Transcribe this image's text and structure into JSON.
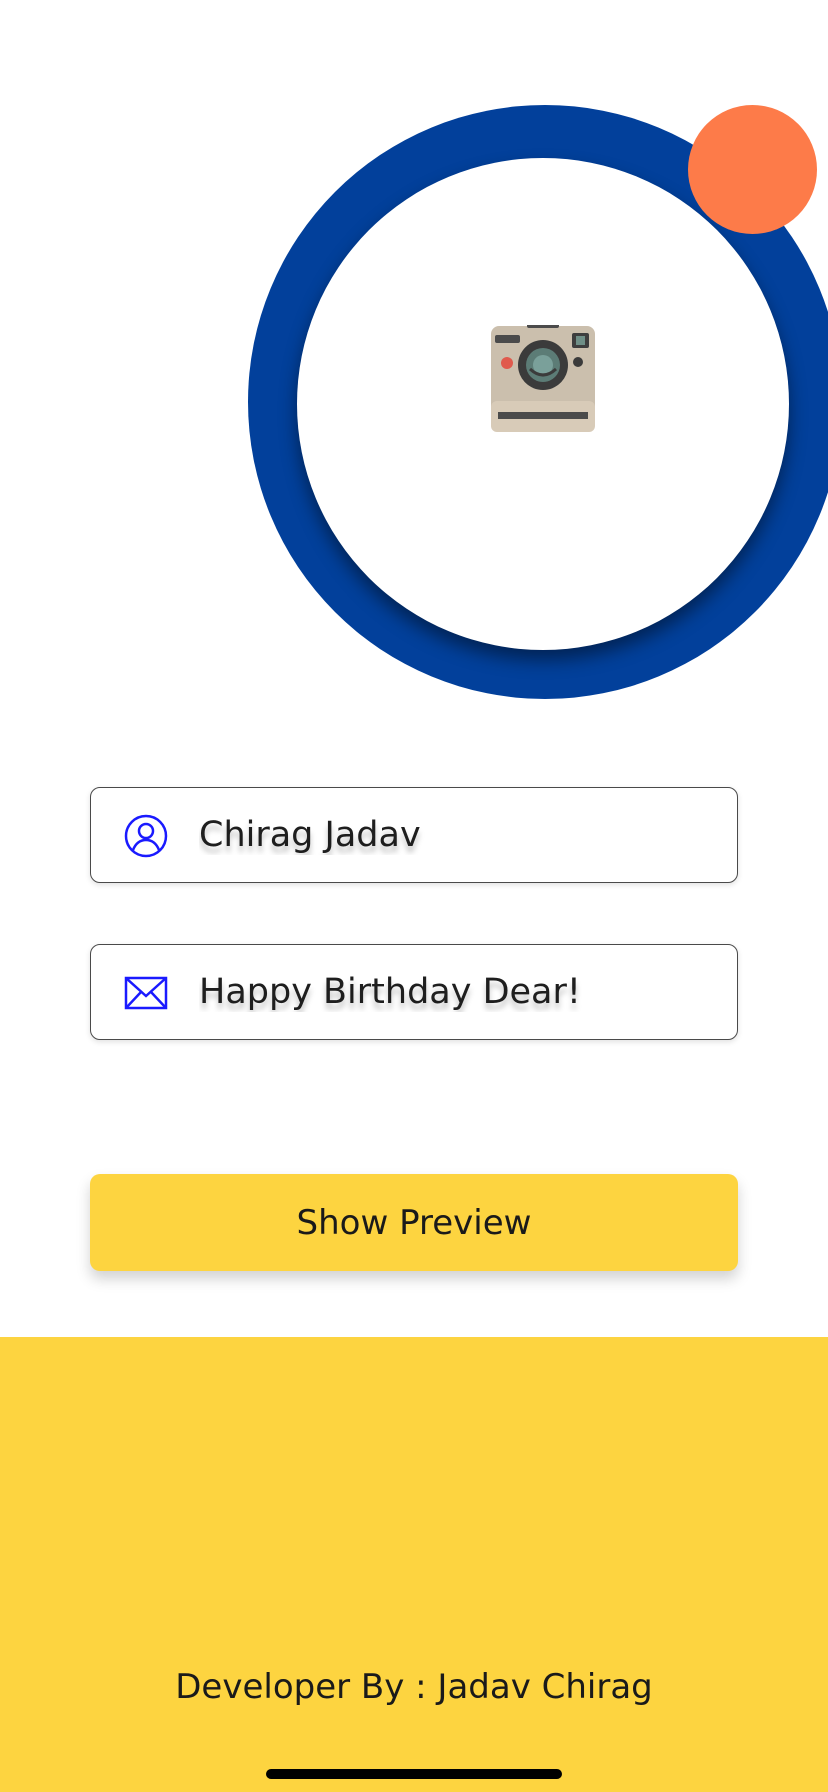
{
  "profile": {
    "photo_icon": "camera-icon",
    "ring_color": "#02409b",
    "badge_color": "#fd7b49"
  },
  "form": {
    "name": {
      "icon": "user-icon",
      "value": "Chirag Jadav"
    },
    "message": {
      "icon": "envelope-icon",
      "value": "Happy Birthday Dear!"
    },
    "preview_button_label": "Show Preview",
    "accent_color": "#fdd440",
    "icon_color": "#1a1aff"
  },
  "footer": {
    "credit": "Developer By : Jadav Chirag"
  }
}
